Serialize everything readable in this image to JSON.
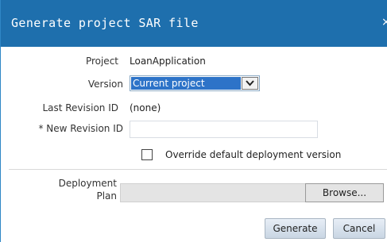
{
  "dialog": {
    "title": "Generate project SAR file",
    "close_glyph": "×"
  },
  "form": {
    "project_label": "Project",
    "project_value": "LoanApplication",
    "version_label": "Version",
    "version_selected": "Current project",
    "last_revision_label": "Last Revision ID",
    "last_revision_value": "(none)",
    "new_revision_label": "* New Revision ID",
    "new_revision_value": "",
    "override_label": "Override default deployment version",
    "override_checked": false,
    "deployment_plan_label_line1": "Deployment",
    "deployment_plan_label_line2": "Plan",
    "deployment_plan_value": "",
    "browse_label": "Browse..."
  },
  "buttons": {
    "generate_label": "Generate",
    "cancel_label": "Cancel"
  },
  "icons": {
    "close": "close-icon",
    "dropdown": "chevron-down-icon"
  },
  "colors": {
    "titlebar": "#1e6fad",
    "selection": "#2d73c8"
  }
}
